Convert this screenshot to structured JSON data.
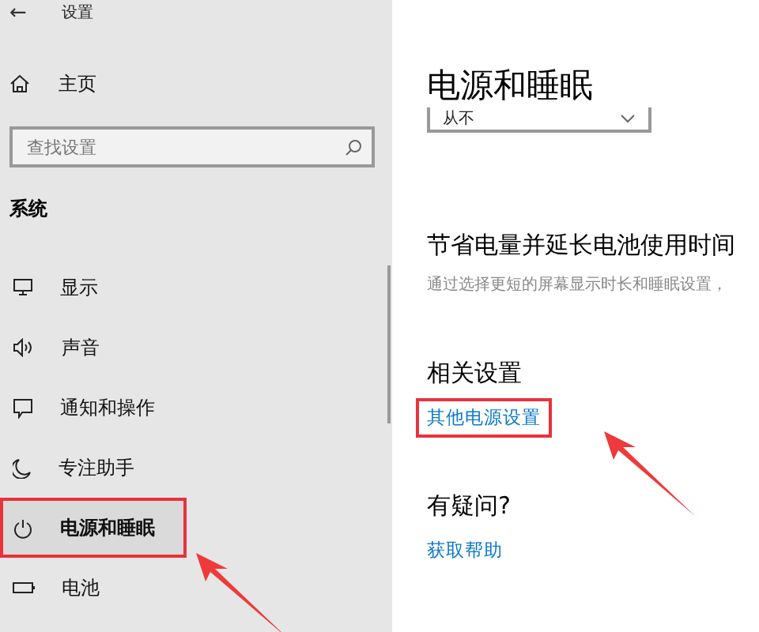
{
  "sidebar": {
    "back": "←",
    "title": "设置",
    "home": {
      "label": "主页"
    },
    "search": {
      "placeholder": "查找设置"
    },
    "section": "系统",
    "items": [
      {
        "label": "显示",
        "selected": false,
        "highlighted": false
      },
      {
        "label": "声音",
        "selected": false,
        "highlighted": false
      },
      {
        "label": "通知和操作",
        "selected": false,
        "highlighted": false
      },
      {
        "label": "专注助手",
        "selected": false,
        "highlighted": false
      },
      {
        "label": "电源和睡眠",
        "selected": true,
        "highlighted": true
      },
      {
        "label": "电池",
        "selected": false,
        "highlighted": false
      }
    ]
  },
  "main": {
    "title": "电源和睡眠",
    "dropdown": {
      "value": "从不"
    },
    "sections": [
      {
        "heading": "节省电量并延长电池使用时间",
        "description": "通过选择更短的屏幕显示时长和睡眠设置，"
      },
      {
        "heading": "相关设置",
        "link": "其他电源设置",
        "highlighted": true
      },
      {
        "heading": "有疑问?",
        "link": "获取帮助",
        "highlighted": false
      }
    ]
  }
}
